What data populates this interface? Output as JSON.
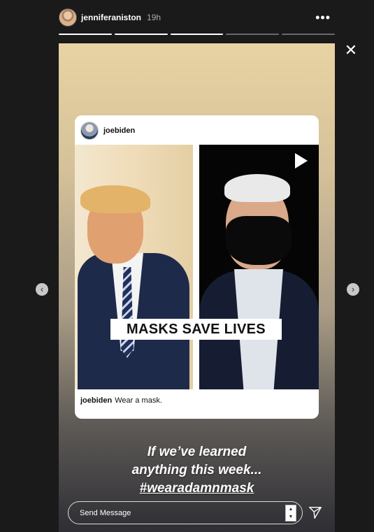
{
  "header": {
    "username": "jenniferaniston",
    "time": "19h",
    "more_icon": "more-icon"
  },
  "progress": {
    "segments_total": 5,
    "segments_completed": 3
  },
  "post": {
    "username": "joebiden",
    "banner_text": "MASKS SAVE LIVES",
    "caption_user": "joebiden",
    "caption_text": "Wear a mask."
  },
  "overlay": {
    "line1": "If we’ve learned",
    "line2": "anything this week...",
    "hashtag": "#wearadamnmask"
  },
  "message": {
    "placeholder": "Send Message"
  },
  "colors": {
    "background": "#1a1a1a",
    "story_top": "#e8d3a3",
    "story_bottom": "#2e2e34"
  }
}
